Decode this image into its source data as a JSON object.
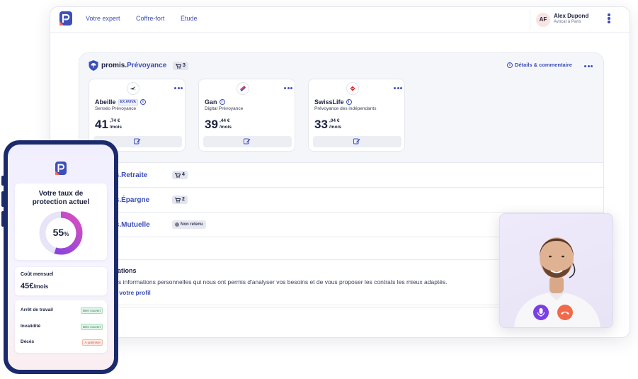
{
  "nav": {
    "items": [
      "Votre expert",
      "Coffre-fort",
      "Étude"
    ]
  },
  "user": {
    "initials": "AF",
    "name": "Alex Dupond",
    "role": "Avocat à Paris"
  },
  "prevoyance": {
    "brand_prefix": "promis.",
    "brand_name": "Prévoyance",
    "count": "3",
    "details_label": "Détails & commentaire",
    "offers": [
      {
        "insurer": "Abeille",
        "tag": "EX AVIVA",
        "product": "Senséo Prévoyance",
        "price_int": "41",
        "price_dec": ",74 €",
        "per": "/mois"
      },
      {
        "insurer": "Gan",
        "tag": "",
        "product": "Digital Prévoyance",
        "price_int": "39",
        "price_dec": ",44 €",
        "per": "/mois"
      },
      {
        "insurer": "SwissLife",
        "tag": "",
        "product": "Prévoyance des indépendants",
        "price_int": "33",
        "price_dec": ",04 €",
        "per": "/mois"
      }
    ]
  },
  "rows": [
    {
      "brand_name": "is.Retraite",
      "count": "4"
    },
    {
      "brand_name": "is.Épargne",
      "count": "2"
    },
    {
      "brand_name": "is.Mutuelle",
      "status": "Non retenu"
    }
  ],
  "infos": {
    "title": "mations",
    "text": "vos informations personnelles qui nous ont permis d'analyser vos besoins et de vous proposer les contrats les mieux adaptés.",
    "link": "er votre profil"
  },
  "phone": {
    "rate_title_line1": "Votre taux de",
    "rate_title_line2": "protection actuel",
    "rate_percent": "55",
    "rate_percent_sign": "%",
    "rate_value": 55,
    "cost_label": "Coût mensuel",
    "cost_value": "45€",
    "cost_unit": "/mois",
    "coverages": [
      {
        "label": "Arrêt de travail",
        "status": "Bien couvert",
        "level": "good"
      },
      {
        "label": "Invalidité",
        "status": "Bien couvert",
        "level": "good"
      },
      {
        "label": "Décès",
        "status": "À optimiser",
        "level": "warn"
      }
    ]
  },
  "colors": {
    "primary": "#3d4fb8",
    "navy": "#1a2a6c",
    "accent_purple": "#7b3fe4",
    "hangup": "#f06a4a"
  }
}
